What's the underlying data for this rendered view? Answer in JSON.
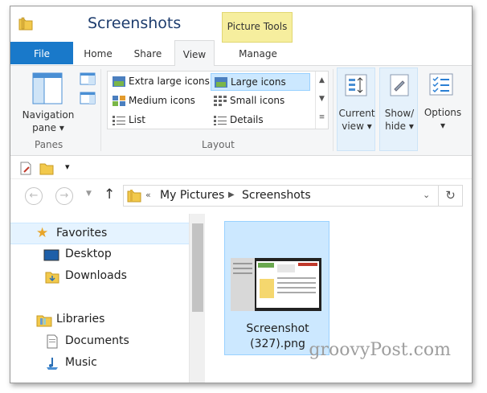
{
  "window": {
    "title": "Screenshots",
    "context_tab": "Picture Tools"
  },
  "tabs": [
    "File",
    "Home",
    "Share",
    "View",
    "Manage"
  ],
  "ribbon": {
    "navigation_pane": {
      "label_line1": "Navigation",
      "label_line2": "pane"
    },
    "panes_group": "Panes",
    "layout": {
      "items": [
        "Extra large icons",
        "Large icons",
        "Medium icons",
        "Small icons",
        "List",
        "Details"
      ],
      "selected": "Large icons",
      "group_label": "Layout"
    },
    "current_view": {
      "line1": "Current",
      "line2": "view"
    },
    "show_hide": {
      "line1": "Show/",
      "line2": "hide"
    },
    "options": {
      "label": "Options"
    }
  },
  "address": {
    "overflow": "«",
    "crumbs": [
      "My Pictures",
      "Screenshots"
    ]
  },
  "nav_pane": {
    "items": [
      {
        "label": "Favorites",
        "icon": "star-icon"
      },
      {
        "label": "Desktop",
        "icon": "desktop-icon"
      },
      {
        "label": "Downloads",
        "icon": "downloads-folder-icon"
      },
      {
        "label": "Libraries",
        "icon": "libraries-icon"
      },
      {
        "label": "Documents",
        "icon": "documents-icon"
      },
      {
        "label": "Music",
        "icon": "music-icon"
      }
    ]
  },
  "files": [
    {
      "name_line1": "Screenshot",
      "name_line2": "(327).png"
    }
  ],
  "watermark": "groovyPost.com",
  "colors": {
    "file_tab": "#1979ca",
    "context_tab": "#f6ee9e",
    "selection": "#cce8ff",
    "title": "#1e3d6e"
  }
}
